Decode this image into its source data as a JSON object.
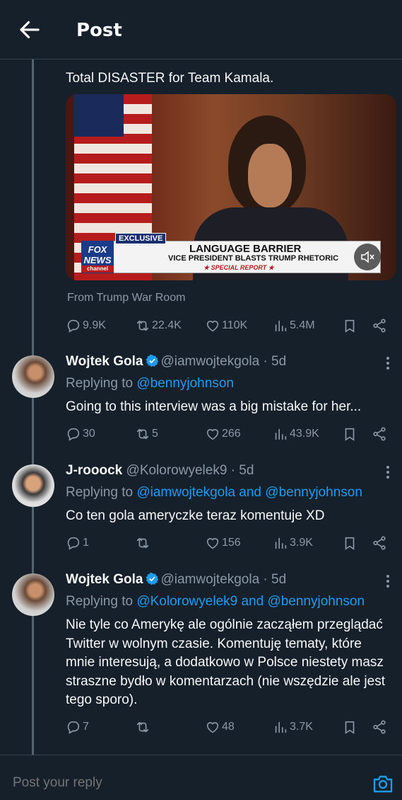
{
  "header": {
    "title": "Post"
  },
  "post": {
    "text": "Total DISASTER for Team Kamala.",
    "media": {
      "exclusive": "EXCLUSIVE",
      "logo_top": "FOX",
      "logo_mid": "NEWS",
      "logo_bottom": "channel",
      "headline": "LANGUAGE BARRIER",
      "subline": "VICE PRESIDENT BLASTS TRUMP RHETORIC",
      "special": "★ SPECIAL REPORT ★"
    },
    "source": "From Trump War Room",
    "stats": {
      "replies": "9.9K",
      "reposts": "22.4K",
      "likes": "110K",
      "views": "5.4M"
    }
  },
  "replies": [
    {
      "name": "Wojtek Gola",
      "verified": true,
      "handle": "@iamwojtekgola · 5d",
      "replying_label": "Replying to ",
      "mentions": "@bennyjohnson",
      "text": "Going to this interview was a big mistake for her...",
      "stats": {
        "replies": "30",
        "reposts": "5",
        "likes": "266",
        "views": "43.9K"
      }
    },
    {
      "name": "J-rooock",
      "verified": false,
      "handle": "@Kolorowyelek9 · 5d",
      "replying_label": "Replying to ",
      "mentions": "@iamwojtekgola and @bennyjohnson",
      "text": "Co ten gola ameryczke teraz komentuje XD",
      "stats": {
        "replies": "1",
        "reposts": "",
        "likes": "156",
        "views": "3.9K"
      }
    },
    {
      "name": "Wojtek Gola",
      "verified": true,
      "handle": "@iamwojtekgola · 5d",
      "replying_label": "Replying to ",
      "mentions": "@Kolorowyelek9 and @bennyjohnson",
      "text": "Nie tyle co Amerykę ale ogólnie zacząłem przeglądać Twitter w wolnym czasie. Komentuję tematy, które mnie interesują, a dodatkowo w Polsce niestety masz straszne bydło w komentarzach (nie wszędzie ale jest tego sporo).",
      "stats": {
        "replies": "7",
        "reposts": "",
        "likes": "48",
        "views": "3.7K"
      }
    }
  ],
  "compose": {
    "placeholder": "Post your reply"
  },
  "colors": {
    "background": "#15202b",
    "accent": "#1d9bf0",
    "muted": "#8b98a5",
    "border": "#38444d"
  }
}
